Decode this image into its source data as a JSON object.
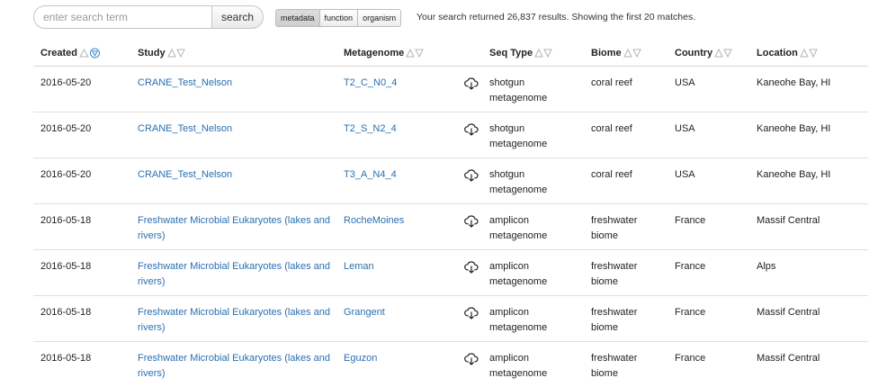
{
  "search": {
    "placeholder": "enter search term",
    "button_label": "search"
  },
  "filters": [
    {
      "label": "metadata",
      "active": true
    },
    {
      "label": "function",
      "active": false
    },
    {
      "label": "organism",
      "active": false
    }
  ],
  "result_summary": "Your search returned 26,837 results. Showing the first 20 matches.",
  "table": {
    "columns": [
      {
        "label": "Created",
        "sort_state": "descending"
      },
      {
        "label": "Study"
      },
      {
        "label": "Metagenome"
      },
      {
        "label": ""
      },
      {
        "label": "Seq Type"
      },
      {
        "label": "Biome"
      },
      {
        "label": "Country"
      },
      {
        "label": "Location"
      }
    ],
    "rows": [
      {
        "created": "2016-05-20",
        "study": "CRANE_Test_Nelson",
        "metagenome": "T2_C_N0_4",
        "seq_type": "shotgun metagenome",
        "biome": "coral reef",
        "country": "USA",
        "location": "Kaneohe Bay, HI"
      },
      {
        "created": "2016-05-20",
        "study": "CRANE_Test_Nelson",
        "metagenome": "T2_S_N2_4",
        "seq_type": "shotgun metagenome",
        "biome": "coral reef",
        "country": "USA",
        "location": "Kaneohe Bay, HI"
      },
      {
        "created": "2016-05-20",
        "study": "CRANE_Test_Nelson",
        "metagenome": "T3_A_N4_4",
        "seq_type": "shotgun metagenome",
        "biome": "coral reef",
        "country": "USA",
        "location": "Kaneohe Bay, HI"
      },
      {
        "created": "2016-05-18",
        "study": "Freshwater Microbial Eukaryotes (lakes and rivers)",
        "metagenome": "RocheMoines",
        "seq_type": "amplicon metagenome",
        "biome": "freshwater biome",
        "country": "France",
        "location": "Massif Central"
      },
      {
        "created": "2016-05-18",
        "study": "Freshwater Microbial Eukaryotes (lakes and rivers)",
        "metagenome": "Leman",
        "seq_type": "amplicon metagenome",
        "biome": "freshwater biome",
        "country": "France",
        "location": "Alps"
      },
      {
        "created": "2016-05-18",
        "study": "Freshwater Microbial Eukaryotes (lakes and rivers)",
        "metagenome": "Grangent",
        "seq_type": "amplicon metagenome",
        "biome": "freshwater biome",
        "country": "France",
        "location": "Massif Central"
      },
      {
        "created": "2016-05-18",
        "study": "Freshwater Microbial Eukaryotes (lakes and rivers)",
        "metagenome": "Eguzon",
        "seq_type": "amplicon metagenome",
        "biome": "freshwater biome",
        "country": "France",
        "location": "Massif Central"
      }
    ]
  },
  "icons": {
    "download": "cloud-download-icon",
    "sort": "sort-arrows-icon",
    "sort_active": "sort-descending-circle-icon"
  },
  "colors": {
    "link": "#2a6fb0",
    "sort_active": "#3a8ad0",
    "sort_inactive": "#b5b5b5"
  }
}
